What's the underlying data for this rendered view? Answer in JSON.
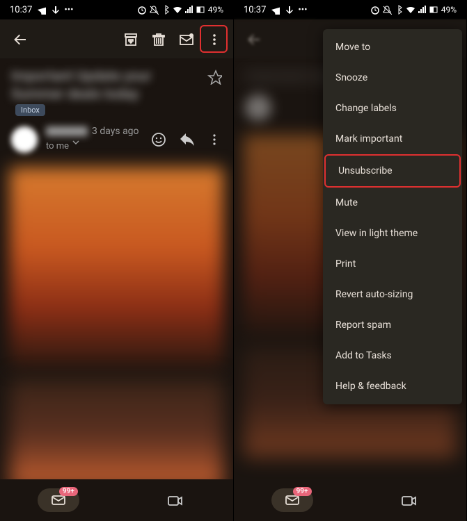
{
  "status": {
    "time": "10:37",
    "battery": "49%"
  },
  "email": {
    "inbox_label": "Inbox",
    "date": "3 days ago",
    "to_prefix": "to me",
    "badge": "99+"
  },
  "menu": {
    "items": [
      {
        "label": "Move to",
        "hl": false
      },
      {
        "label": "Snooze",
        "hl": false
      },
      {
        "label": "Change labels",
        "hl": false
      },
      {
        "label": "Mark important",
        "hl": false
      },
      {
        "label": "Unsubscribe",
        "hl": true
      },
      {
        "label": "Mute",
        "hl": false
      },
      {
        "label": "View in light theme",
        "hl": false
      },
      {
        "label": "Print",
        "hl": false
      },
      {
        "label": "Revert auto-sizing",
        "hl": false
      },
      {
        "label": "Report spam",
        "hl": false
      },
      {
        "label": "Add to Tasks",
        "hl": false
      },
      {
        "label": "Help & feedback",
        "hl": false
      }
    ]
  }
}
